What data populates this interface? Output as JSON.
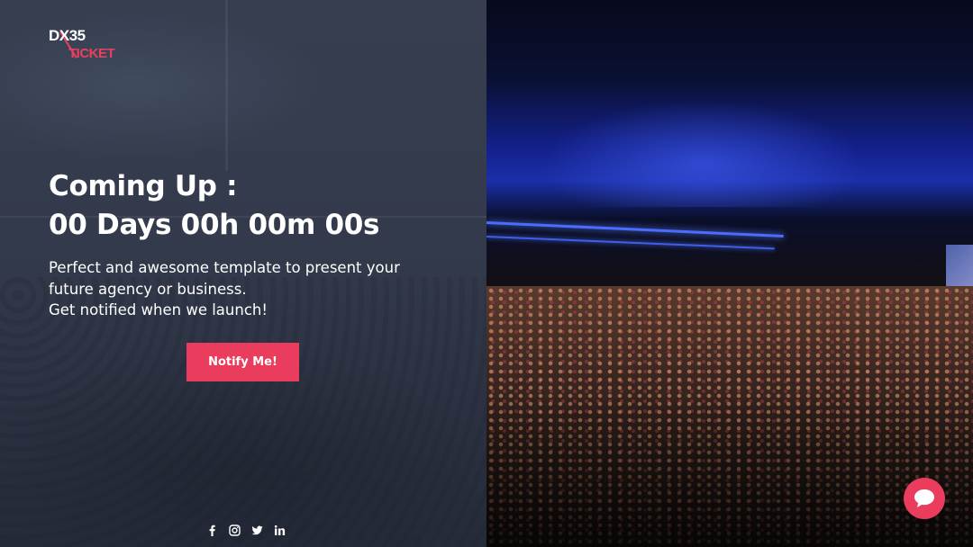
{
  "brand": {
    "logo_top": "DX35",
    "logo_bottom": "TICKET"
  },
  "hero": {
    "headline_line1": "Coming Up :",
    "headline_line2": "00 Days 00h 00m 00s",
    "description_line1": "Perfect and awesome template to present your",
    "description_line2": "future agency or business.",
    "description_line3": "Get notified when we launch!",
    "notify_label": "Notify Me!"
  },
  "social": [
    "facebook-icon",
    "instagram-icon",
    "twitter-icon",
    "linkedin-icon"
  ],
  "chat": {
    "icon": "chat-bubble-icon"
  },
  "colors": {
    "accent": "#ea3d5e",
    "panel": "#343b4c",
    "text": "#ffffff"
  }
}
